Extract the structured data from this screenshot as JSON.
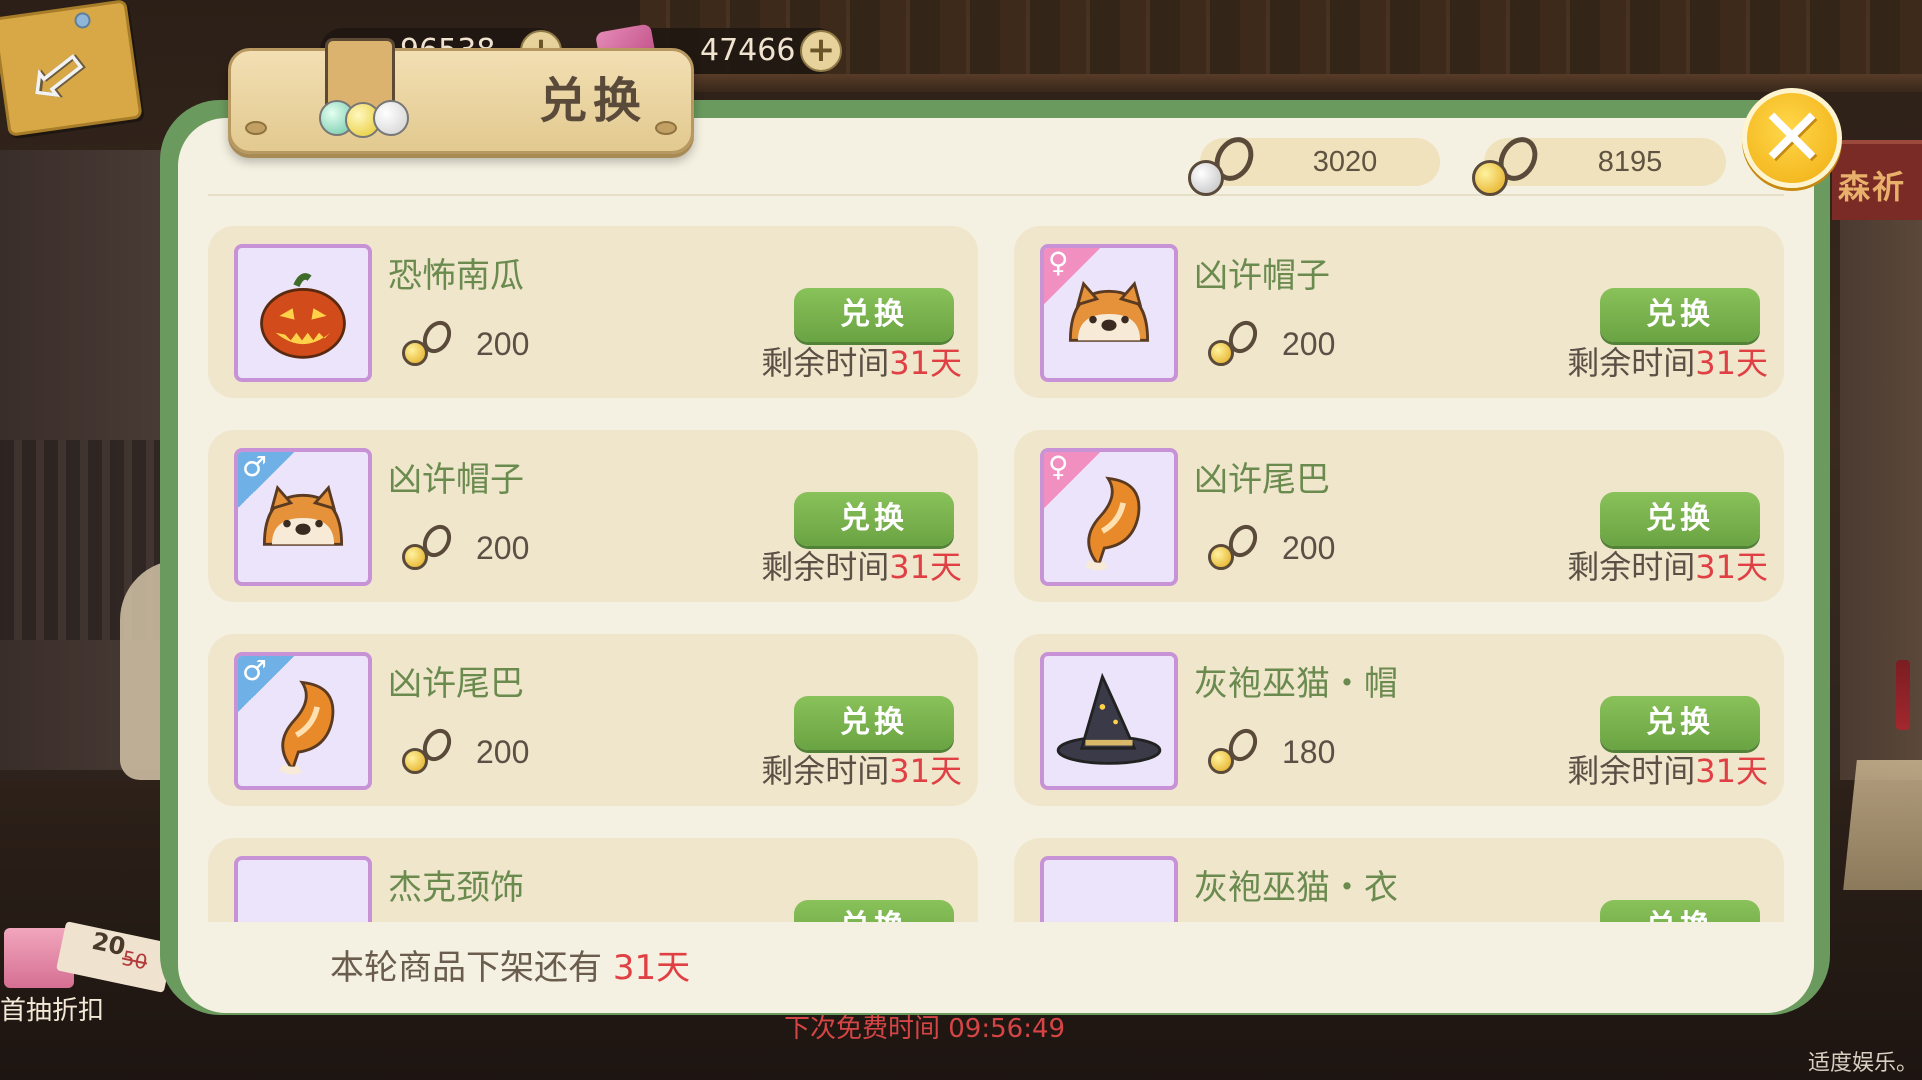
{
  "currencies": {
    "top1": {
      "value": "96538",
      "icon": "bell-icon"
    },
    "top2": {
      "value": "47466",
      "icon": "gem-icon"
    }
  },
  "dialog": {
    "title": "兑换",
    "close_icon": "close-icon",
    "tokens": [
      {
        "icon": "silver-token-icon",
        "value": "3020"
      },
      {
        "icon": "gold-token-icon",
        "value": "8195"
      }
    ],
    "button_label": "兑换",
    "time_prefix": "剩余时间",
    "items": [
      {
        "name": "恐怖南瓜",
        "cost": "200",
        "days": "31天",
        "token": "gold",
        "gender": "",
        "art": "pumpkin"
      },
      {
        "name": "凶许帽子",
        "cost": "200",
        "days": "31天",
        "token": "gold",
        "gender": "♀",
        "art": "shiba-hat"
      },
      {
        "name": "凶许帽子",
        "cost": "200",
        "days": "31天",
        "token": "gold",
        "gender": "♂",
        "art": "shiba-hat"
      },
      {
        "name": "凶许尾巴",
        "cost": "200",
        "days": "31天",
        "token": "gold",
        "gender": "♀",
        "art": "tail"
      },
      {
        "name": "凶许尾巴",
        "cost": "200",
        "days": "31天",
        "token": "gold",
        "gender": "♂",
        "art": "tail"
      },
      {
        "name": "灰袍巫猫・帽",
        "cost": "180",
        "days": "31天",
        "token": "gold",
        "gender": "",
        "art": "witch-hat"
      },
      {
        "name": "杰克颈饰",
        "cost": "",
        "days": "",
        "token": "gold",
        "gender": "",
        "art": "collar"
      },
      {
        "name": "灰袍巫猫・衣",
        "cost": "",
        "days": "",
        "token": "gold",
        "gender": "",
        "art": "robe"
      }
    ],
    "footer_prefix": "本轮商品下架还有",
    "footer_days": "31天"
  },
  "background": {
    "next_free": "下次免费时间  09:56:49",
    "first_draw_discount": "首抽折扣",
    "discount_new": "20",
    "discount_old": "50",
    "right_sign": "森祈",
    "health_notice": "适度娱乐。"
  },
  "colors": {
    "accent_green": "#6aa342",
    "name_green": "#6a8a4e",
    "red": "#e04043",
    "frame_green": "#6a9a5e",
    "female": "#f08fc0",
    "male": "#6fb0e6"
  }
}
